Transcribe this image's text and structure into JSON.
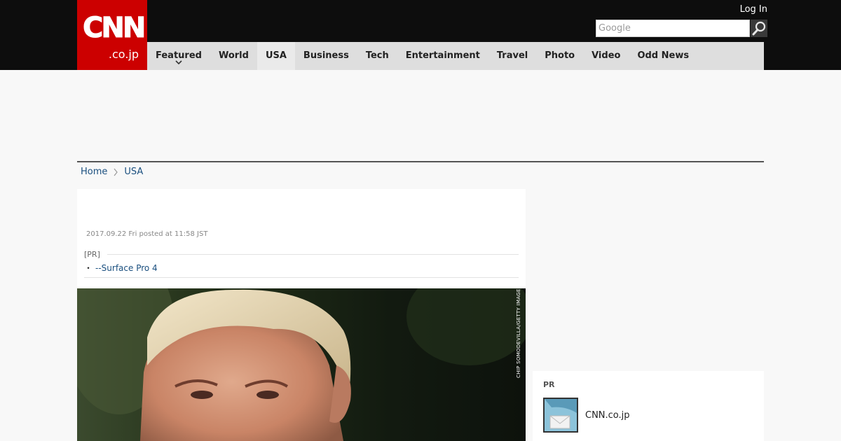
{
  "logo": {
    "main": "CNN",
    "sub": ".co.jp"
  },
  "header": {
    "login_label": "Log In",
    "search_placeholder": "Google"
  },
  "nav": {
    "items": [
      {
        "label": "Featured",
        "has_dropdown": true
      },
      {
        "label": "World"
      },
      {
        "label": "USA",
        "active": true
      },
      {
        "label": "Business"
      },
      {
        "label": "Tech"
      },
      {
        "label": "Entertainment"
      },
      {
        "label": "Travel"
      },
      {
        "label": "Photo"
      },
      {
        "label": "Video"
      },
      {
        "label": "Odd News"
      }
    ]
  },
  "breadcrumb": {
    "home": "Home",
    "current": "USA"
  },
  "article": {
    "posted": "2017.09.22 Fri posted at 11:58 JST",
    "pr_label": "[PR]",
    "pr_bullet": "・",
    "pr_link": "--Surface Pro 4",
    "photo_credit": "CHIP SOMODEVILLA/GETTY IMAGES"
  },
  "sidebar": {
    "pr_title": "PR",
    "pr_item_text": "CNN.co.jp"
  },
  "colors": {
    "brand": "#cc0000",
    "topbar": "#0d0d0d",
    "nav": "#dedede",
    "link": "#1a4f7f"
  },
  "icons": {
    "search": "magnifier-icon",
    "dropdown": "chevron-down-icon",
    "separator": "chevron-right-icon"
  }
}
